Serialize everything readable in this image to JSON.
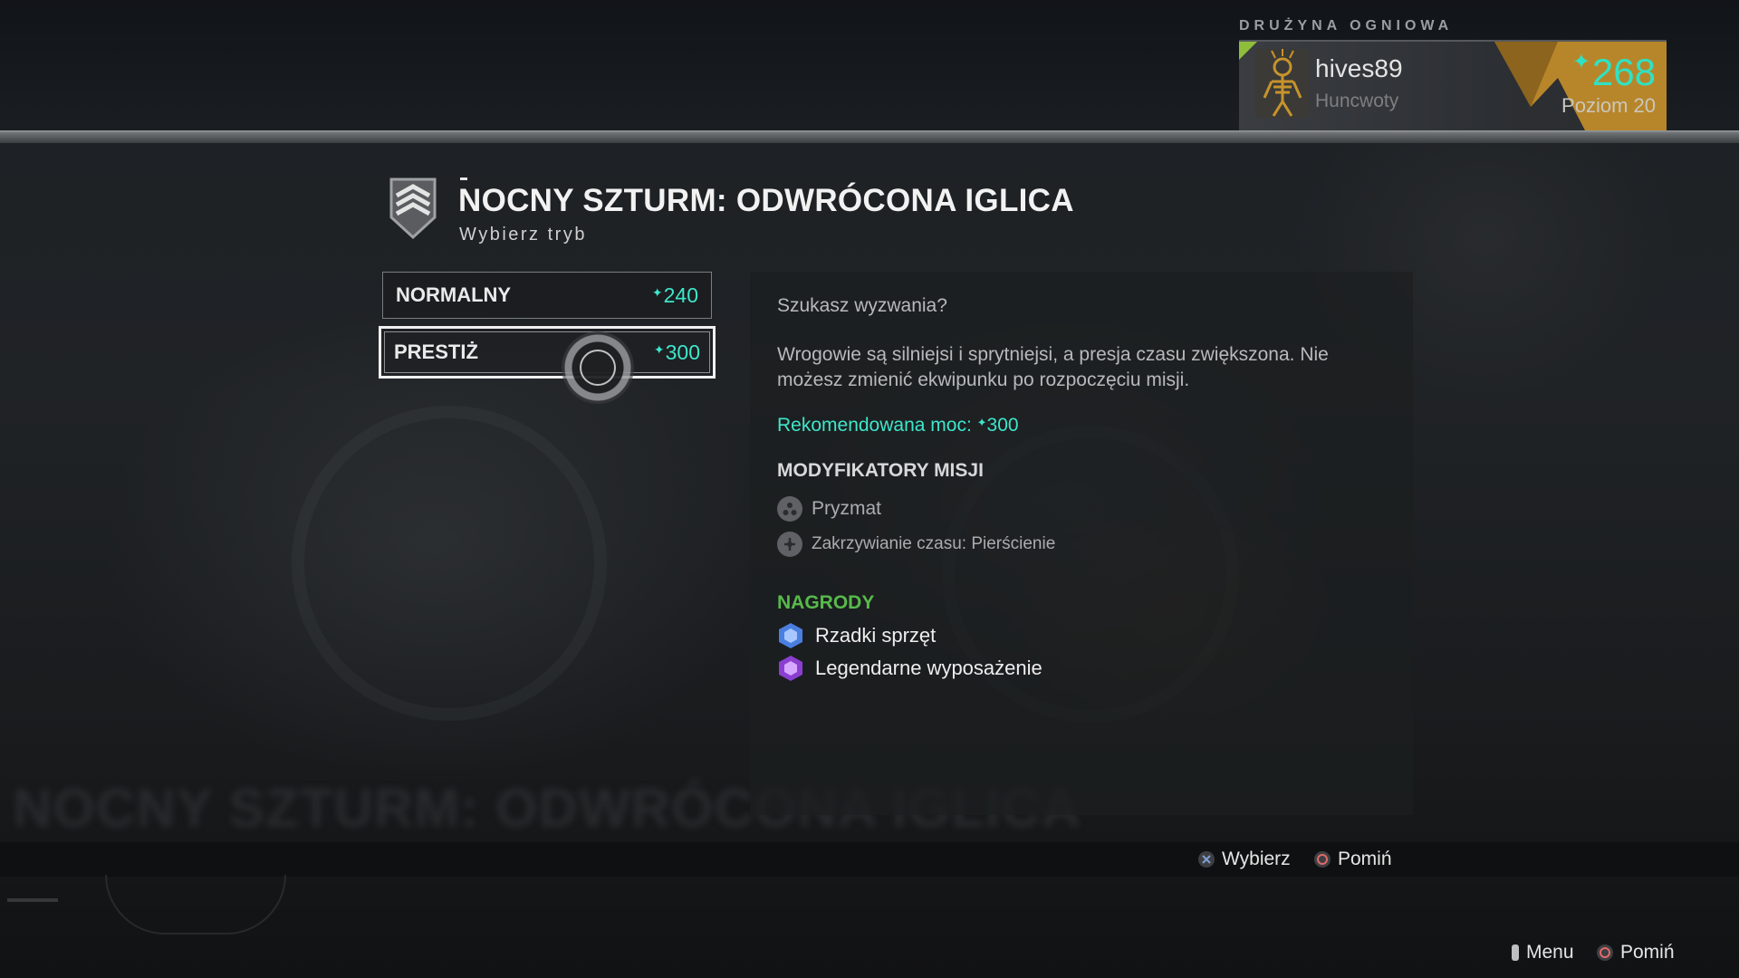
{
  "fireteam": {
    "label": "DRUŻYNA OGNIOWA",
    "player": {
      "name": "hives89",
      "clan": "Huncwoty",
      "power": "268",
      "level": "Poziom 20"
    }
  },
  "activity": {
    "title": "NOCNY SZTURM: ODWRÓCONA IGLICA",
    "subtitle": "Wybierz tryb",
    "background_title": "NOCNY SZTURM: ODWRÓCONA IGLICA"
  },
  "modes": [
    {
      "label": "NORMALNY",
      "power": "240",
      "selected": false
    },
    {
      "label": "PRESTIŻ",
      "power": "300",
      "selected": true
    }
  ],
  "details": {
    "intro": "Szukasz wyzwania?",
    "description": "Wrogowie są silniejsi i sprytniejsi, a presja czasu zwiększona. Nie możesz zmienić ekwipunku po rozpoczęciu misji.",
    "recommended_label": "Rekomendowana moc: ",
    "recommended_power": "300",
    "modifiers_heading": "MODYFIKATORY MISJI",
    "modifiers": [
      {
        "label": "Pryzmat",
        "icon": "prism-modifier-icon"
      },
      {
        "label": "Zakrzywianie czasu: Pierścienie",
        "icon": "timewarp-rings-icon"
      }
    ],
    "rewards_heading": "NAGRODY",
    "rewards": [
      {
        "label": "Rzadki sprzęt",
        "icon": "rare-gear-icon",
        "color": "#4a7fe0"
      },
      {
        "label": "Legendarne wyposażenie",
        "icon": "legendary-gear-icon",
        "color": "#8a3fd0"
      }
    ]
  },
  "hints": {
    "select_label": "Wybierz",
    "skip_label": "Pomiń",
    "menu_label": "Menu",
    "skip2_label": "Pomiń"
  },
  "colors": {
    "power_accent": "#3ee6cb",
    "rewards_heading": "#58b94c",
    "rank_flag": "#b8862a",
    "emblem_corner": "#8fbf3a"
  }
}
